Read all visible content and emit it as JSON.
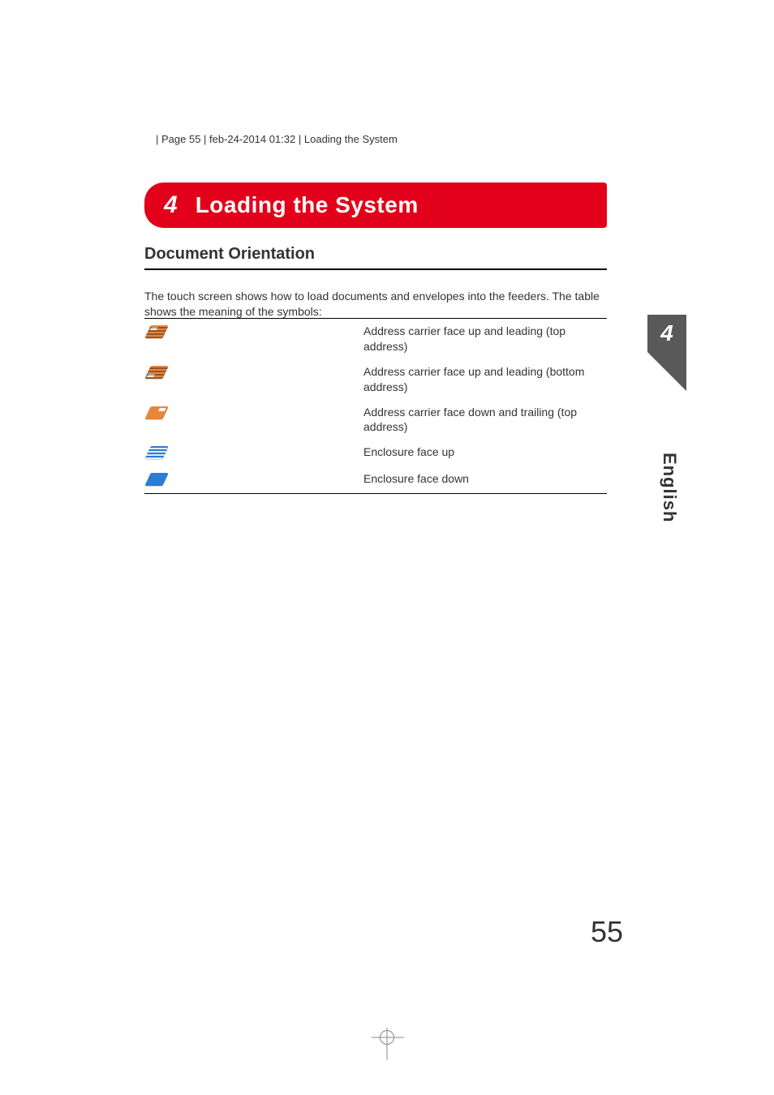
{
  "header": {
    "line": "  | Page 55 | feb-24-2014 01:32 | Loading the System"
  },
  "chapter": {
    "number": "4",
    "title": "Loading the System"
  },
  "section": {
    "title": "Document Orientation",
    "intro": "The touch screen shows how to load documents and envelopes into the feeders. The table shows the meaning of the symbols:"
  },
  "rows": [
    {
      "icon": "address-face-up-leading-top-icon",
      "desc": "Address carrier face up and leading (top address)"
    },
    {
      "icon": "address-face-up-leading-bottom-icon",
      "desc": "Address carrier face up and leading (bottom address)"
    },
    {
      "icon": "address-face-down-trailing-top-icon",
      "desc": "Address carrier face down and trailing (top address)"
    },
    {
      "icon": "enclosure-face-up-icon",
      "desc": "Enclosure face up"
    },
    {
      "icon": "enclosure-face-down-icon",
      "desc": "Enclosure face down"
    }
  ],
  "side": {
    "tab": "4",
    "lang": "English"
  },
  "page_number": "55"
}
